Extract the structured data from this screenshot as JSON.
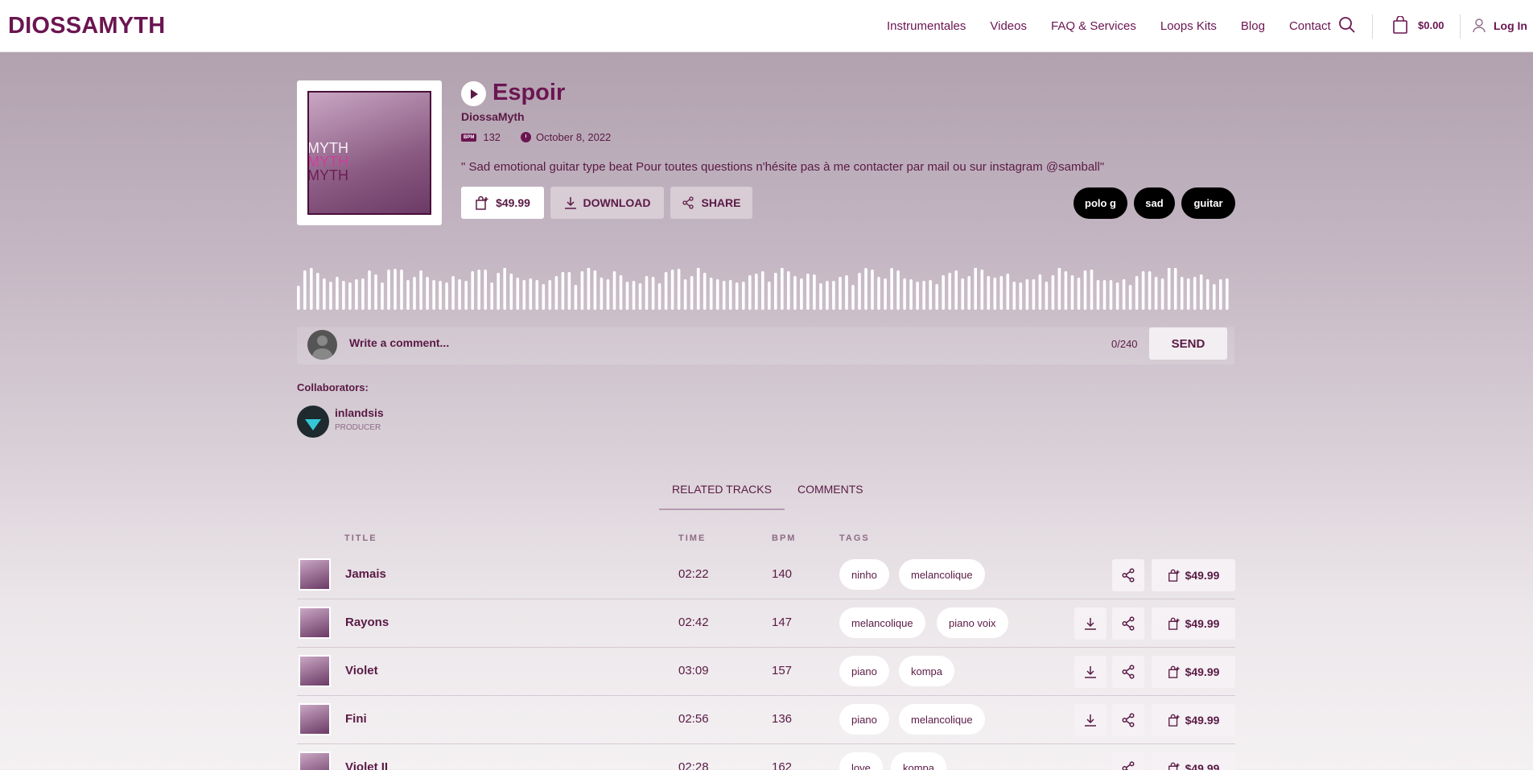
{
  "header": {
    "logo": "DIOSSAMYTH",
    "nav": [
      "Instrumentales",
      "Videos",
      "FAQ & Services",
      "Loops Kits",
      "Blog",
      "Contact"
    ],
    "cart_total": "$0.00",
    "login_label": "Log In"
  },
  "track": {
    "title": "Espoir",
    "artist": "DiossaMyth",
    "bpm_badge": "BPM",
    "bpm": "132",
    "date": "October 8, 2022",
    "description": "\" Sad emotional guitar type beat Pour toutes questions n'hésite pas à me contacter par mail ou sur instagram @samball\"",
    "cover_text": "AMYTH",
    "buy_label": "$49.99",
    "download_label": "DOWNLOAD",
    "share_label": "SHARE",
    "tags": [
      "polo g",
      "sad",
      "guitar"
    ]
  },
  "comment": {
    "placeholder": "Write a comment...",
    "count": "0/240",
    "send_label": "SEND"
  },
  "collaborators": {
    "label": "Collaborators:",
    "items": [
      {
        "name": "inlandsis",
        "role": "PRODUCER"
      }
    ]
  },
  "tabs": [
    {
      "label": "RELATED TRACKS",
      "active": true
    },
    {
      "label": "COMMENTS",
      "active": false
    }
  ],
  "table": {
    "headers": {
      "title": "TITLE",
      "time": "TIME",
      "bpm": "BPM",
      "tags": "TAGS"
    },
    "rows": [
      {
        "title": "Jamais",
        "time": "02:22",
        "bpm": "140",
        "tags": [
          "ninho",
          "melancolique"
        ],
        "price": "$49.99",
        "download": false
      },
      {
        "title": "Rayons",
        "time": "02:42",
        "bpm": "147",
        "tags": [
          "melancolique",
          "piano voix"
        ],
        "price": "$49.99",
        "download": true
      },
      {
        "title": "Violet",
        "time": "03:09",
        "bpm": "157",
        "tags": [
          "piano",
          "kompa"
        ],
        "price": "$49.99",
        "download": true
      },
      {
        "title": "Fini",
        "time": "02:56",
        "bpm": "136",
        "tags": [
          "piano",
          "melancolique"
        ],
        "price": "$49.99",
        "download": true
      },
      {
        "title": "Violet II",
        "time": "02:28",
        "bpm": "162",
        "tags": [
          "love",
          "kompa"
        ],
        "price": "$49.99",
        "download": true
      }
    ]
  },
  "colors": {
    "brand": "#6b1551",
    "text": "#5a1a45"
  }
}
